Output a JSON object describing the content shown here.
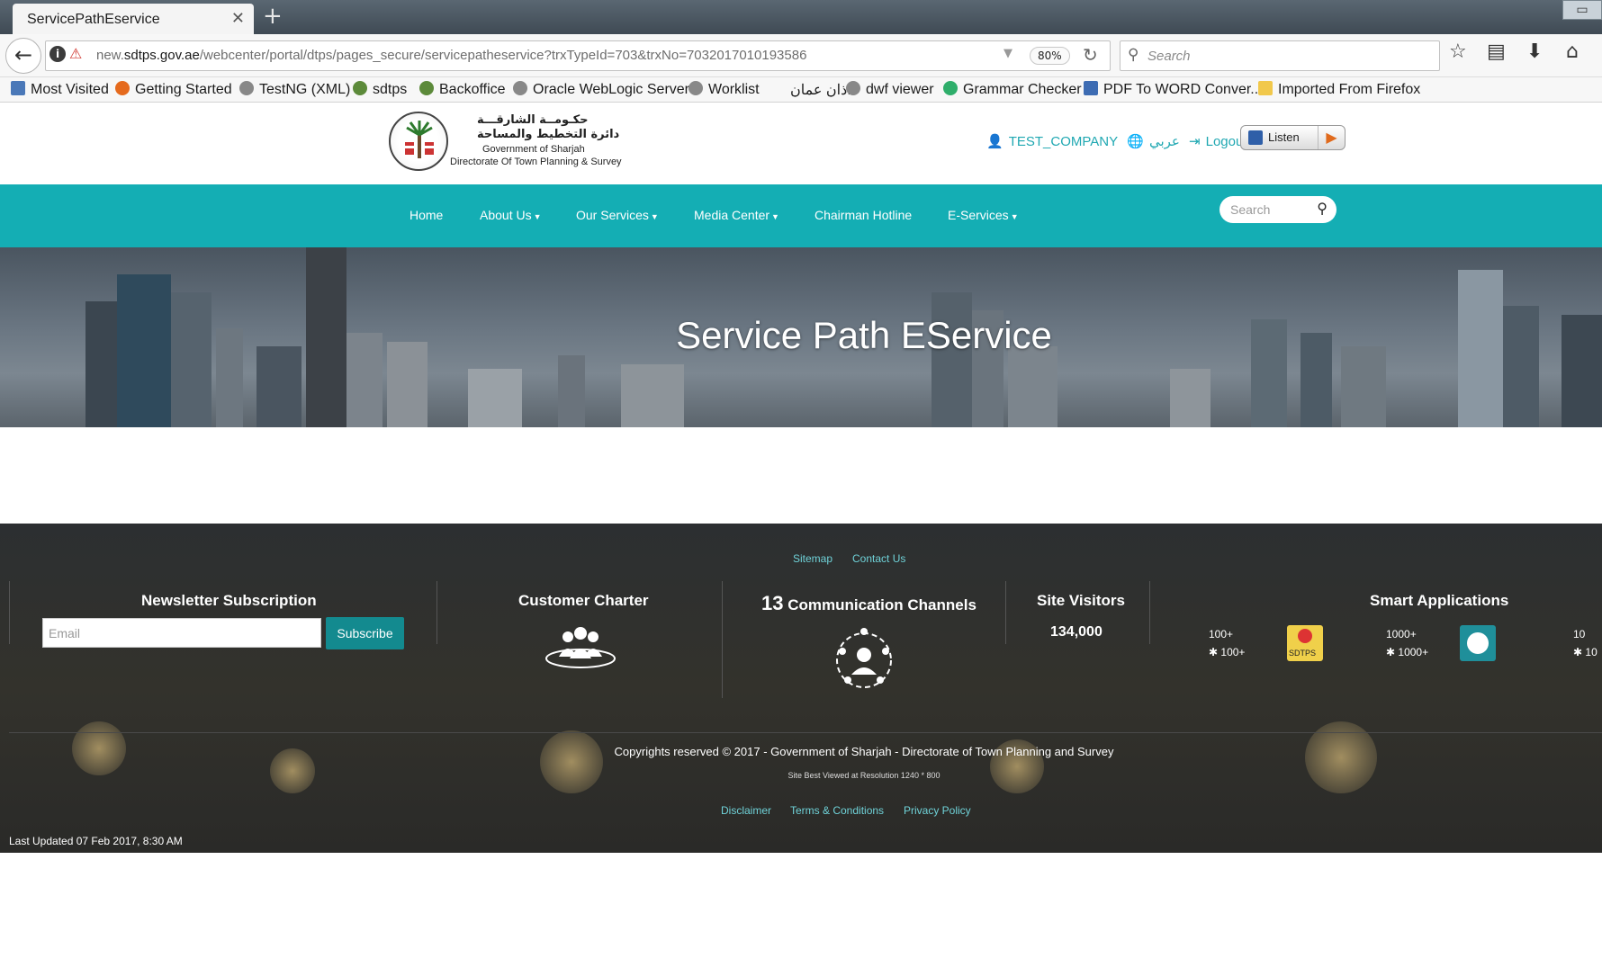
{
  "browser": {
    "tab_title": "ServicePathEservice",
    "url_prefix": "new.",
    "url_domain": "sdtps.gov.ae",
    "url_path": "/webcenter/portal/dtps/pages_secure/servicepatheservice?trxTypeId=703&trxNo=7032017010193586",
    "zoom": "80%",
    "search_placeholder": "Search",
    "bookmarks": [
      "Most Visited",
      "Getting Started",
      "TestNG (XML)",
      "sdtps",
      "Backoffice",
      "Oracle WebLogic Server",
      "Worklist",
      "اذان عمان",
      "dwf viewer",
      "Grammar Checker",
      "PDF To WORD Conver...",
      "Imported From Firefox"
    ]
  },
  "header": {
    "logo_ar_line1": "حكـومــة الشارقـــة",
    "logo_ar_line2": "دائرة التخطيط والمساحة",
    "logo_en_line1": "Government of Sharjah",
    "logo_en_line2": "Directorate Of Town Planning & Survey",
    "user": "TEST_COMPANY",
    "arabic_link": "عربي",
    "logout": "Logout",
    "listen": "Listen"
  },
  "nav": {
    "items": [
      "Home",
      "About Us",
      "Our Services",
      "Media Center",
      "Chairman Hotline",
      "E-Services"
    ],
    "search_placeholder": "Search"
  },
  "hero": {
    "title": "Service Path EService"
  },
  "footer": {
    "top_links": [
      "Sitemap",
      "Contact Us"
    ],
    "newsletter_heading": "Newsletter Subscription",
    "email_placeholder": "Email",
    "subscribe": "Subscribe",
    "charter_heading": "Customer Charter",
    "channels_count": "13",
    "channels_heading": "Communication Channels",
    "visitors_heading": "Site Visitors",
    "visitors_count": "134,000",
    "smart_apps_heading": "Smart Applications",
    "app1_ios": "100+",
    "app1_android": "100+",
    "app1_name": "SDTPS",
    "app2_ios": "1000+",
    "app2_android": "1000+",
    "app3_ios": "10",
    "app3_android": "10",
    "copyright": "Copyrights reserved © 2017 - Government of Sharjah - Directorate of Town Planning and Survey",
    "best_view": "Site Best Viewed at Resolution 1240 * 800",
    "legal_links": [
      "Disclaimer",
      "Terms & Conditions",
      "Privacy Policy"
    ],
    "last_updated": "Last Updated 07 Feb 2017, 8:30 AM"
  }
}
